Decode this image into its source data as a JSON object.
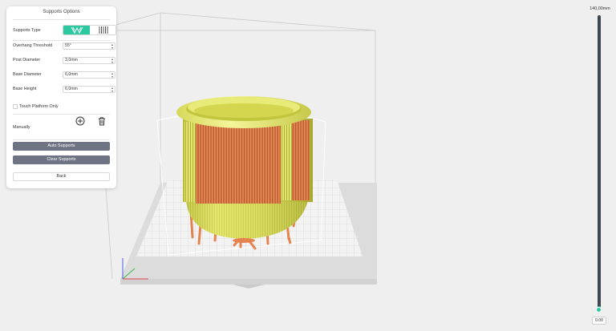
{
  "panel": {
    "title": "Supports Options",
    "supports_type_label": "Supports Type",
    "supports_type_options": [
      "tree-supports-icon",
      "linear-supports-icon"
    ],
    "overhang_label": "Overhang Threshold",
    "overhang_value": "55°",
    "post_diameter_label": "Post Diameter",
    "post_diameter_value": "3,0mm",
    "base_diameter_label": "Base Diameter",
    "base_diameter_value": "6,0mm",
    "base_height_label": "Base Height",
    "base_height_value": "6,0mm",
    "touch_platform_label": "Touch Platform Only",
    "touch_platform_checked": false,
    "manually_label": "Manually",
    "auto_supports_label": "Auto Supports",
    "clear_supports_label": "Clear Supports",
    "back_label": "Back"
  },
  "slider": {
    "max_label": "140,00mm",
    "min_value": "0.00",
    "level": 0
  },
  "colors": {
    "accent": "#2cc9a0",
    "model": "#eef07a",
    "supports": "#e0824f",
    "slider_track": "#3e4650",
    "button_dark": "#6f7484"
  }
}
